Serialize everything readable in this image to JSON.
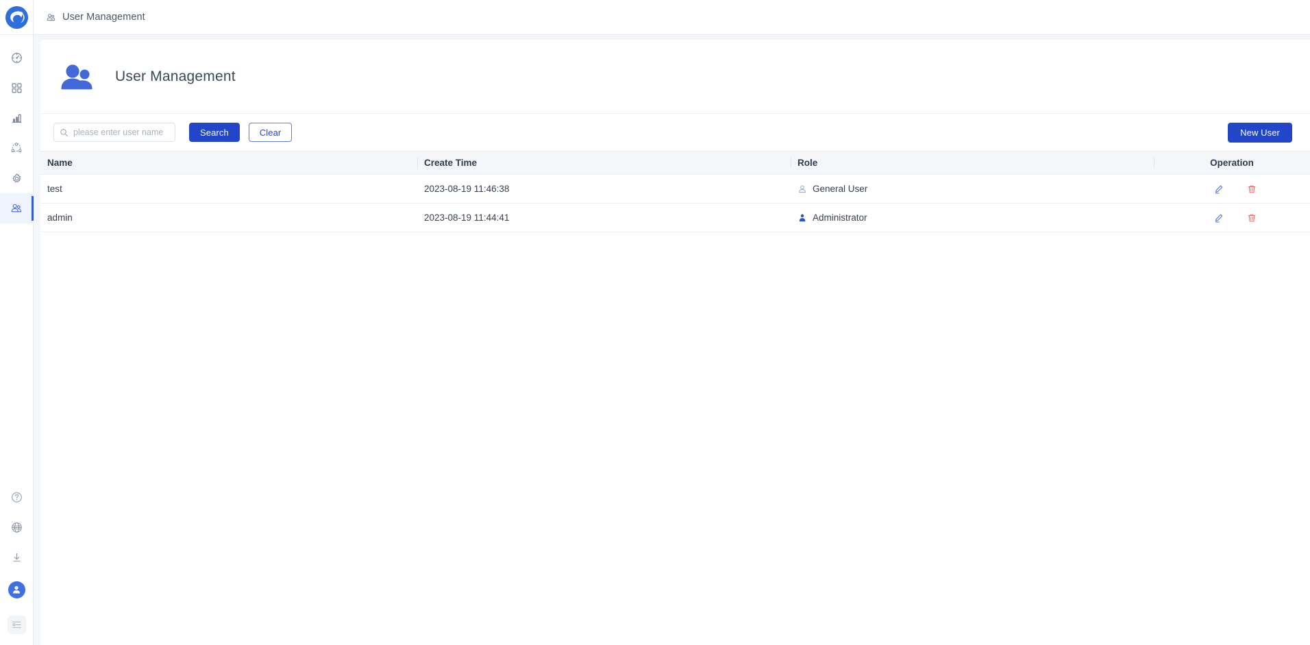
{
  "app": {
    "logo_name": "app-logo",
    "accent_blue": "#2346c8",
    "icon_blue": "#4169d8",
    "danger_red": "#f05a5a",
    "header_bg": "#f4f6fa"
  },
  "breadcrumb": {
    "icon": "users-icon",
    "label": "User Management"
  },
  "sidebar": {
    "top_items": [
      {
        "icon": "dashboard-gauge-icon",
        "name": "sidebar-item-dashboard",
        "active": false
      },
      {
        "icon": "grid-apps-icon",
        "name": "sidebar-item-apps",
        "active": false
      },
      {
        "icon": "bar-chart-icon",
        "name": "sidebar-item-analytics",
        "active": false
      },
      {
        "icon": "topology-network-icon",
        "name": "sidebar-item-topology",
        "active": false
      },
      {
        "icon": "gear-settings-icon",
        "name": "sidebar-item-settings",
        "active": false
      },
      {
        "icon": "users-icon",
        "name": "sidebar-item-users",
        "active": true
      }
    ],
    "bottom_items": [
      {
        "icon": "help-question-icon",
        "name": "sidebar-item-help"
      },
      {
        "icon": "globe-language-icon",
        "name": "sidebar-item-language"
      },
      {
        "icon": "download-icon",
        "name": "sidebar-item-download"
      }
    ],
    "avatar": "user-avatar-icon",
    "collapse": "collapse-panel-icon"
  },
  "page": {
    "icon": "users-group-icon",
    "title": "User Management"
  },
  "toolbar": {
    "search_placeholder": "please enter user name",
    "search_value": "",
    "search_icon": "search-icon",
    "search_button": "Search",
    "clear_button": "Clear",
    "new_user_button": "New User"
  },
  "table": {
    "columns": [
      "Name",
      "Create Time",
      "Role",
      "Operation"
    ],
    "rows": [
      {
        "name": "test",
        "create_time": "2023-08-19 11:46:38",
        "role": "General User",
        "role_icon": "user-outline-icon",
        "edit_icon": "edit-pencil-icon",
        "delete_icon": "trash-delete-icon"
      },
      {
        "name": "admin",
        "create_time": "2023-08-19 11:44:41",
        "role": "Administrator",
        "role_icon": "user-filled-icon",
        "edit_icon": "edit-pencil-icon",
        "delete_icon": "trash-delete-icon"
      }
    ]
  }
}
